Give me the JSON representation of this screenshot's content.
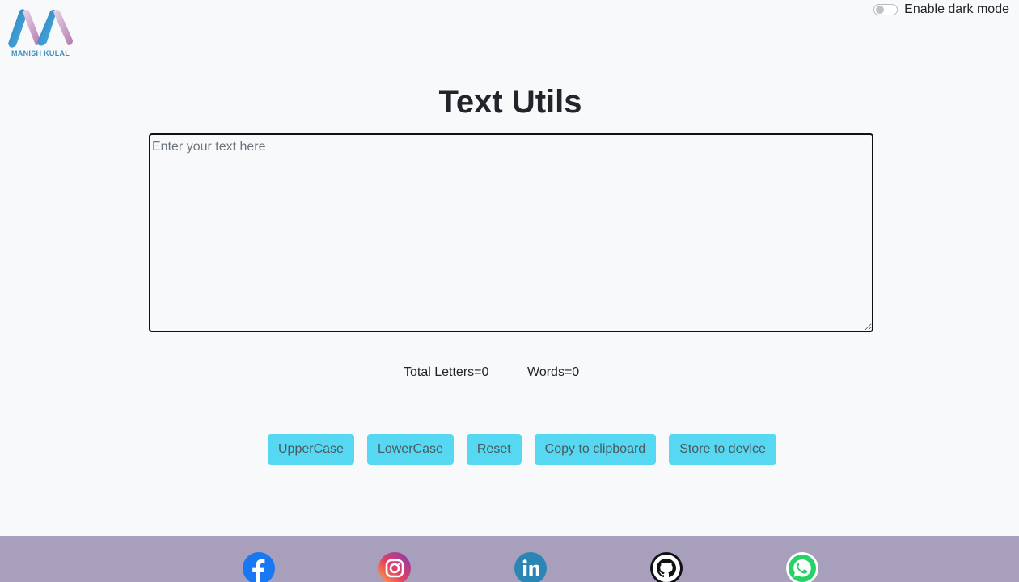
{
  "logo": {
    "text": "MANISH KULAL"
  },
  "dark_mode": {
    "label": "Enable dark mode",
    "enabled": false
  },
  "main": {
    "title": "Text Utils",
    "textarea": {
      "placeholder": "Enter your text here",
      "value": ""
    },
    "stats": {
      "letters": "Total Letters=0",
      "words": "Words=0"
    },
    "buttons": {
      "uppercase": "UpperCase",
      "lowercase": "LowerCase",
      "reset": "Reset",
      "copy": "Copy to clipboard",
      "store": "Store to device"
    }
  },
  "footer": {
    "socials": [
      "facebook-icon",
      "instagram-icon",
      "linkedin-icon",
      "github-icon",
      "whatsapp-icon"
    ]
  },
  "colors": {
    "background": "#f8f9fa",
    "button": "#57d8f2",
    "footer": "#a89fbd"
  }
}
